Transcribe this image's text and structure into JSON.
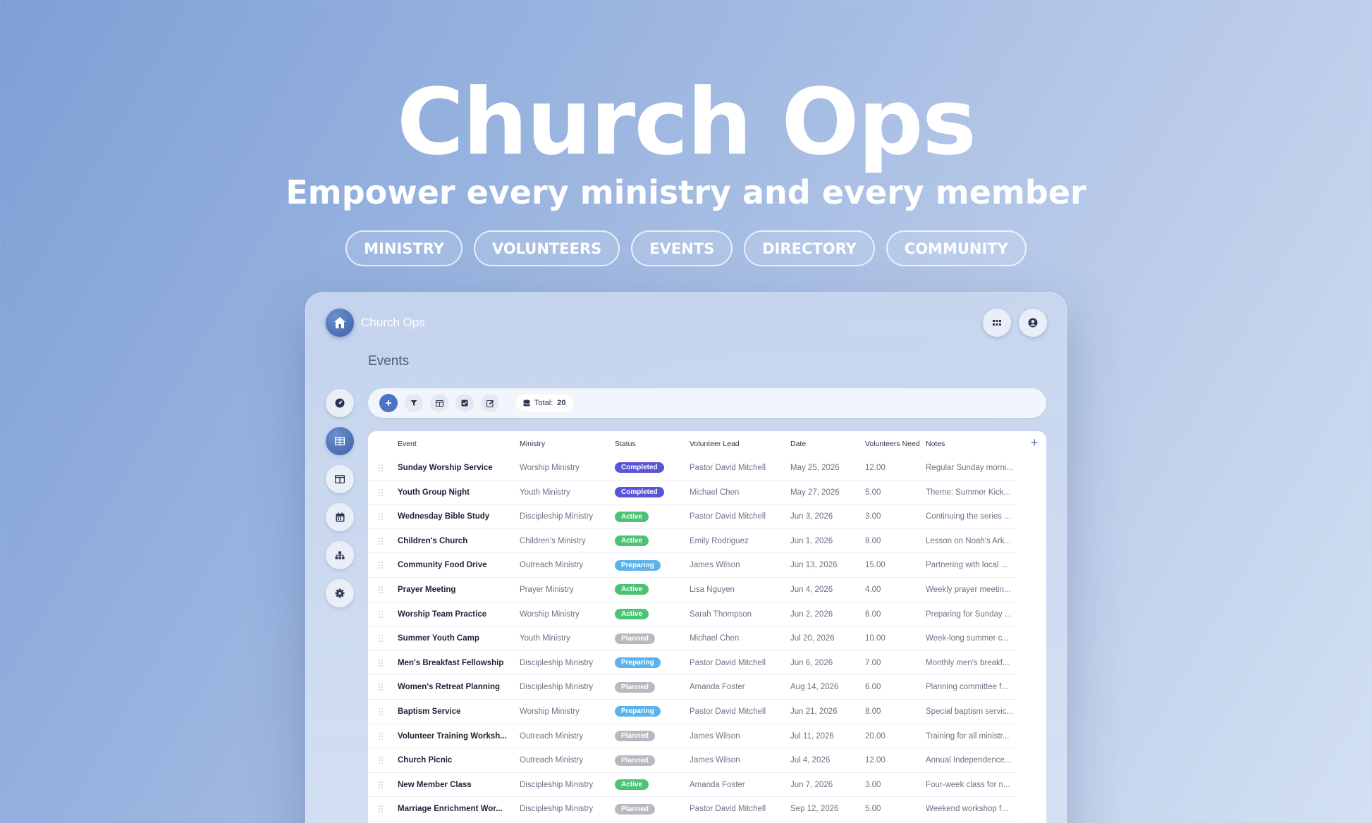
{
  "hero": {
    "title": "Church Ops",
    "subtitle": "Empower every ministry and every member",
    "pills": [
      "MINISTRY",
      "VOLUNTEERS",
      "EVENTS",
      "DIRECTORY",
      "COMMUNITY"
    ]
  },
  "app": {
    "name": "Church Ops",
    "logo_icon": "church-icon",
    "top_buttons": [
      "apps-grid-icon",
      "user-account-icon"
    ]
  },
  "page": {
    "title": "Events"
  },
  "sidebar": {
    "items": [
      {
        "icon": "dashboard-gauge-icon",
        "active": false
      },
      {
        "icon": "table-icon",
        "active": true
      },
      {
        "icon": "columns-layout-icon",
        "active": false
      },
      {
        "icon": "calendar-icon",
        "active": false
      },
      {
        "icon": "org-chart-icon",
        "active": false
      },
      {
        "icon": "settings-gear-icon",
        "active": false
      }
    ]
  },
  "toolbar": {
    "buttons": [
      "add-icon",
      "filter-icon",
      "columns-icon",
      "checkbox-icon",
      "edit-icon"
    ],
    "total_label": "Total:",
    "total_value": "20"
  },
  "table": {
    "columns": [
      "Event",
      "Ministry",
      "Status",
      "Volunteer Lead",
      "Date",
      "Volunteers Need",
      "Notes"
    ],
    "rows": [
      {
        "event": "Sunday Worship Service",
        "ministry": "Worship Ministry",
        "status": "Completed",
        "lead": "Pastor David Mitchell",
        "date": "May 25, 2026",
        "volunteers": "12.00",
        "notes": "Regular Sunday morni..."
      },
      {
        "event": "Youth Group Night",
        "ministry": "Youth Ministry",
        "status": "Completed",
        "lead": "Michael Chen",
        "date": "May 27, 2026",
        "volunteers": "5.00",
        "notes": "Theme: Summer Kick..."
      },
      {
        "event": "Wednesday Bible Study",
        "ministry": "Discipleship Ministry",
        "status": "Active",
        "lead": "Pastor David Mitchell",
        "date": "Jun 3, 2026",
        "volunteers": "3.00",
        "notes": "Continuing the series ..."
      },
      {
        "event": "Children's Church",
        "ministry": "Children's Ministry",
        "status": "Active",
        "lead": "Emily Rodriguez",
        "date": "Jun 1, 2026",
        "volunteers": "8.00",
        "notes": "Lesson on Noah's Ark..."
      },
      {
        "event": "Community Food Drive",
        "ministry": "Outreach Ministry",
        "status": "Preparing",
        "lead": "James Wilson",
        "date": "Jun 13, 2026",
        "volunteers": "15.00",
        "notes": "Partnering with local ..."
      },
      {
        "event": "Prayer Meeting",
        "ministry": "Prayer Ministry",
        "status": "Active",
        "lead": "Lisa Nguyen",
        "date": "Jun 4, 2026",
        "volunteers": "4.00",
        "notes": "Weekly prayer meetin..."
      },
      {
        "event": "Worship Team Practice",
        "ministry": "Worship Ministry",
        "status": "Active",
        "lead": "Sarah Thompson",
        "date": "Jun 2, 2026",
        "volunteers": "6.00",
        "notes": "Preparing for Sunday ..."
      },
      {
        "event": "Summer Youth Camp",
        "ministry": "Youth Ministry",
        "status": "Planned",
        "lead": "Michael Chen",
        "date": "Jul 20, 2026",
        "volunteers": "10.00",
        "notes": "Week-long summer c..."
      },
      {
        "event": "Men's Breakfast Fellowship",
        "ministry": "Discipleship Ministry",
        "status": "Preparing",
        "lead": "Pastor David Mitchell",
        "date": "Jun 6, 2026",
        "volunteers": "7.00",
        "notes": "Monthly men's breakf..."
      },
      {
        "event": "Women's Retreat Planning",
        "ministry": "Discipleship Ministry",
        "status": "Planned",
        "lead": "Amanda Foster",
        "date": "Aug 14, 2026",
        "volunteers": "6.00",
        "notes": "Planning committee f..."
      },
      {
        "event": "Baptism Service",
        "ministry": "Worship Ministry",
        "status": "Preparing",
        "lead": "Pastor David Mitchell",
        "date": "Jun 21, 2026",
        "volunteers": "8.00",
        "notes": "Special baptism servic..."
      },
      {
        "event": "Volunteer Training Worksh...",
        "ministry": "Outreach Ministry",
        "status": "Planned",
        "lead": "James Wilson",
        "date": "Jul 11, 2026",
        "volunteers": "20.00",
        "notes": "Training for all ministr..."
      },
      {
        "event": "Church Picnic",
        "ministry": "Outreach Ministry",
        "status": "Planned",
        "lead": "James Wilson",
        "date": "Jul 4, 2026",
        "volunteers": "12.00",
        "notes": "Annual Independence..."
      },
      {
        "event": "New Member Class",
        "ministry": "Discipleship Ministry",
        "status": "Active",
        "lead": "Amanda Foster",
        "date": "Jun 7, 2026",
        "volunteers": "3.00",
        "notes": "Four-week class for n..."
      },
      {
        "event": "Marriage Enrichment Wor...",
        "ministry": "Discipleship Ministry",
        "status": "Planned",
        "lead": "Pastor David Mitchell",
        "date": "Sep 12, 2026",
        "volunteers": "5.00",
        "notes": "Weekend workshop f..."
      }
    ]
  },
  "status_colors": {
    "Completed": "#5a55d6",
    "Active": "#4cc274",
    "Preparing": "#5bb3ec",
    "Planned": "#b6b9c0"
  }
}
